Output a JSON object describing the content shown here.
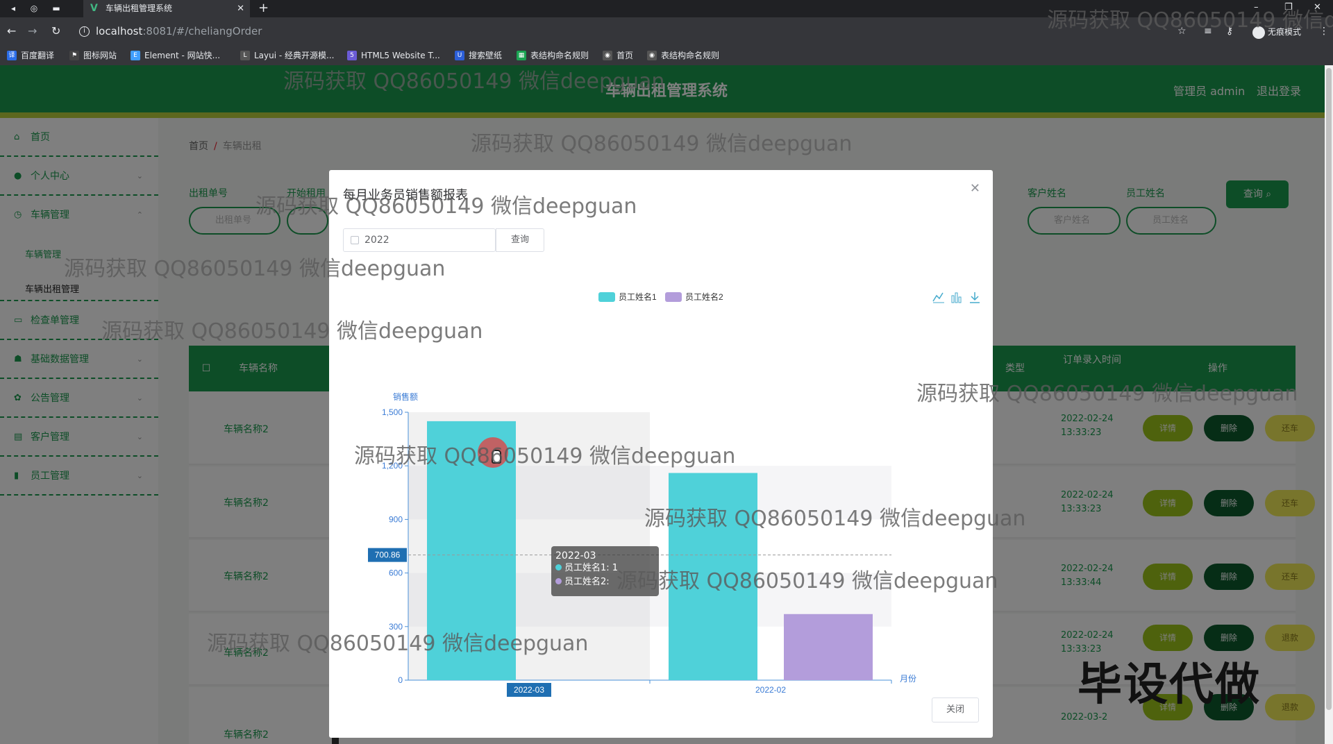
{
  "browser": {
    "tab_title": "车辆出租管理系统",
    "tab_logo": "V",
    "url_host": "localhost",
    "url_path": ":8081/#/cheliangOrder",
    "incognito_label": "无痕模式",
    "bookmarks": [
      {
        "label": "百度翻译",
        "color": "#2b6de8"
      },
      {
        "label": "图标网站",
        "color": "#444444"
      },
      {
        "label": "Element - 网站快...",
        "color": "#409eff"
      },
      {
        "label": "Layui - 经典开源模...",
        "color": "#555555"
      },
      {
        "label": "HTML5 Website T...",
        "color": "#6b5bd6"
      },
      {
        "label": "搜索壁纸",
        "color": "#2c5fd8"
      },
      {
        "label": "表结构命名规则",
        "color": "#1aa352"
      },
      {
        "label": "首页",
        "color": "#555555"
      },
      {
        "label": "表结构命名规则",
        "color": "#555555"
      }
    ]
  },
  "app": {
    "title": "车辆出租管理系统",
    "admin_label": "管理员 admin",
    "logout_label": "退出登录",
    "sidebar": [
      {
        "label": "首页",
        "icon": "home-icon"
      },
      {
        "label": "个人中心",
        "icon": "user-icon"
      },
      {
        "label": "车辆管理",
        "icon": "car-icon"
      },
      {
        "label": "检查单管理",
        "icon": "doc-icon"
      },
      {
        "label": "基础数据管理",
        "icon": "data-icon"
      },
      {
        "label": "公告管理",
        "icon": "notice-icon"
      },
      {
        "label": "客户管理",
        "icon": "customer-icon"
      },
      {
        "label": "员工管理",
        "icon": "staff-icon"
      }
    ],
    "sidebar_sub": [
      "车辆管理",
      "车辆出租管理"
    ],
    "breadcrumb": {
      "home": "首页",
      "current": "车辆出租"
    },
    "filters": {
      "order_no_label": "出租单号",
      "order_no_placeholder": "出租单号",
      "start_label": "开始租用",
      "customer_label": "客户姓名",
      "customer_placeholder": "客户姓名",
      "staff_label": "员工姓名",
      "staff_placeholder": "员工姓名",
      "query_label": "查询"
    },
    "table": {
      "col_name": "车辆名称",
      "col_type": "类型",
      "col_time": "订单录入时间",
      "col_ops": "操作",
      "rows": [
        {
          "name": "车辆名称2",
          "time": "2022-02-24 13:33:23"
        },
        {
          "name": "车辆名称2",
          "time": "2022-02-24 13:33:23"
        },
        {
          "name": "车辆名称2",
          "time": "2022-02-24 13:33:44"
        },
        {
          "name": "车辆名称2",
          "time": "2022-02-24 13:33:23"
        },
        {
          "name": "车辆名称2",
          "time": "2022-03-2"
        }
      ],
      "op_detail": "详情",
      "op_delete": "删除",
      "op_return": "还车",
      "op_return_alt": "退款"
    }
  },
  "modal": {
    "title": "每月业务员销售额报表",
    "year_value": "2022",
    "year_query": "查询",
    "close_label": "关闭",
    "tooltip": {
      "title": "2022-03",
      "row1": "员工姓名1: 1",
      "row2": "员工姓名2:"
    },
    "axis_pointer_label": "700.86",
    "axis_pointer_x": "2022-03"
  },
  "chart_data": {
    "type": "bar",
    "ylabel": "销售额",
    "xlabel": "月份",
    "categories": [
      "2022-03",
      "2022-02"
    ],
    "ylim": [
      0,
      1500
    ],
    "yticks": [
      0,
      300,
      600,
      900,
      1200,
      1500
    ],
    "series": [
      {
        "name": "员工姓名1",
        "color": "#4fd1d9",
        "values": [
          1450,
          1160
        ]
      },
      {
        "name": "员工姓名2",
        "color": "#b39ddb",
        "values": [
          null,
          370
        ]
      }
    ],
    "legend_position": "top-center",
    "grid": true
  },
  "watermarks": [
    "源码获取 QQ86050149 微信deepguan",
    "源码获取 QQ86050149 微信deepguan",
    "源码获取 QQ86050149 微信deepguan",
    "源码获取 QQ86050149 微信deepguan",
    "源码获取 QQ86050149 微信deepguan",
    "源码获取 QQ86050149 微信deepguan",
    "源码获取 QQ86050149 微信deepguan",
    "源码获取 QQ86050149 微信deepguan",
    "源码获取 QQ86050149 微信deepguan",
    "源码获取 QQ86050149 微信deepguan",
    "源码获取 QQ86050149 微信deepguan",
    "源码获取 QQ86050149 微信deepguan"
  ],
  "overlay_badge": "毕设代做"
}
